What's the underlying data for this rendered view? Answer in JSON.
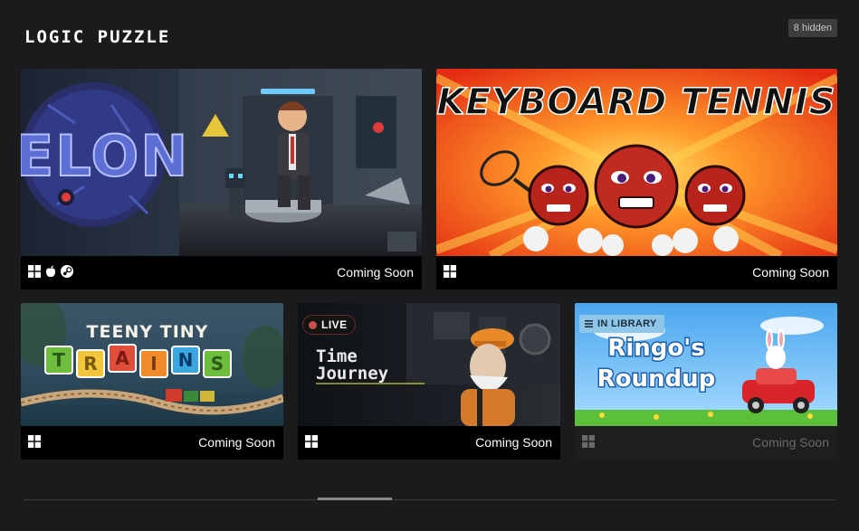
{
  "section": {
    "title": "LOGIC PUZZLE",
    "hidden_count": "8 hidden"
  },
  "games": [
    {
      "name": "ELON",
      "status": "Coming Soon",
      "platforms": [
        "windows-icon",
        "apple-icon",
        "steam-icon"
      ],
      "badge": null
    },
    {
      "name": "KEYBOARD TENNIS",
      "status": "Coming Soon",
      "platforms": [
        "windows-icon"
      ],
      "badge": null
    },
    {
      "name": "TEENY TINY TRAINS",
      "status": "Coming Soon",
      "platforms": [
        "windows-icon"
      ],
      "badge": null
    },
    {
      "name": "Time Journey",
      "status": "Coming Soon",
      "platforms": [
        "windows-icon"
      ],
      "badge": "LIVE"
    },
    {
      "name": "Ringo's Roundup",
      "status": "Coming Soon",
      "platforms": [
        "windows-icon"
      ],
      "badge": "IN LIBRARY"
    }
  ],
  "art_text": {
    "elon": "ELON",
    "tennis": "KEYBOARD TENNIS",
    "trains_top": "TEENY TINY",
    "trains_letters": [
      "T",
      "R",
      "A",
      "I",
      "N",
      "S"
    ],
    "time1": "Time",
    "time2": "Journey",
    "ringo1": "Ringo's",
    "ringo2": "Roundup"
  },
  "colors": {
    "background": "#1b1b1d",
    "card": "#000000",
    "live": "#c9504d",
    "library": "#8ec5e8"
  }
}
